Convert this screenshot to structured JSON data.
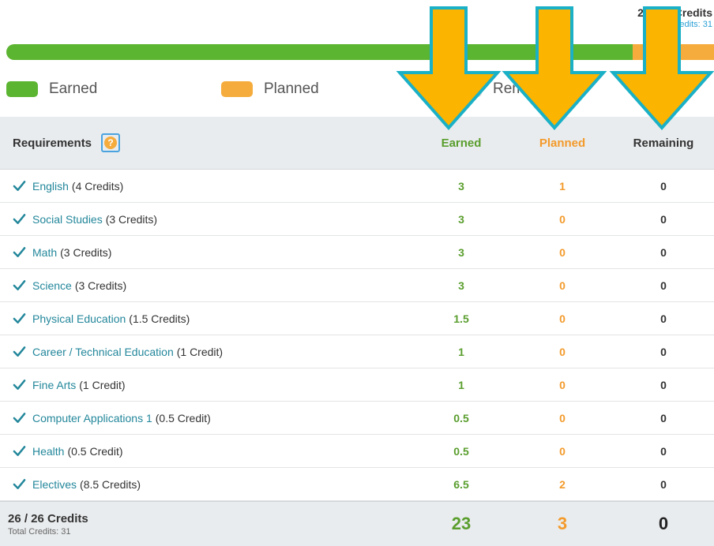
{
  "summary": {
    "credits": "26 / 26 Credits",
    "total": "Total Credits: 31"
  },
  "progress": {
    "earned_fraction": 0.885,
    "planned_fraction": 0.115,
    "colors": {
      "earned": "#5cb531",
      "planned": "#f5ac3d",
      "remaining": "#dcdcdc"
    }
  },
  "legend": [
    {
      "label": "Earned",
      "color": "#5cb531"
    },
    {
      "label": "Planned",
      "color": "#f5ac3d"
    },
    {
      "label": "Remaining",
      "color": "#dcdcdc"
    }
  ],
  "table": {
    "headers": {
      "requirements": "Requirements",
      "help_icon": "?",
      "earned": "Earned",
      "planned": "Planned",
      "remaining": "Remaining"
    },
    "rows": [
      {
        "name": "English",
        "detail": "(4 Credits)",
        "earned": "3",
        "planned": "1",
        "remaining": "0"
      },
      {
        "name": "Social Studies",
        "detail": "(3 Credits)",
        "earned": "3",
        "planned": "0",
        "remaining": "0"
      },
      {
        "name": "Math",
        "detail": "(3 Credits)",
        "earned": "3",
        "planned": "0",
        "remaining": "0"
      },
      {
        "name": "Science",
        "detail": "(3 Credits)",
        "earned": "3",
        "planned": "0",
        "remaining": "0"
      },
      {
        "name": "Physical Education",
        "detail": "(1.5 Credits)",
        "earned": "1.5",
        "planned": "0",
        "remaining": "0"
      },
      {
        "name": "Career / Technical Education",
        "detail": "(1 Credit)",
        "earned": "1",
        "planned": "0",
        "remaining": "0"
      },
      {
        "name": "Fine Arts",
        "detail": "(1 Credit)",
        "earned": "1",
        "planned": "0",
        "remaining": "0"
      },
      {
        "name": "Computer Applications 1",
        "detail": "(0.5 Credit)",
        "earned": "0.5",
        "planned": "0",
        "remaining": "0"
      },
      {
        "name": "Health",
        "detail": "(0.5 Credit)",
        "earned": "0.5",
        "planned": "0",
        "remaining": "0"
      },
      {
        "name": "Electives",
        "detail": "(8.5 Credits)",
        "earned": "6.5",
        "planned": "2",
        "remaining": "0"
      }
    ],
    "footer": {
      "credits": "26 / 26 Credits",
      "total": "Total Credits: 31",
      "earned": "23",
      "planned": "3",
      "remaining": "0"
    }
  },
  "annotations": {
    "arrow_fill": "#fbb400",
    "arrow_outline": "#1ab0c6",
    "arrow_count": 3
  },
  "icons": {
    "check": "check-icon",
    "help": "help-icon"
  },
  "colors": {
    "link": "#23879b",
    "earned": "#5a9e2e",
    "planned": "#f39a2b",
    "header_bg": "#e9ecee"
  }
}
